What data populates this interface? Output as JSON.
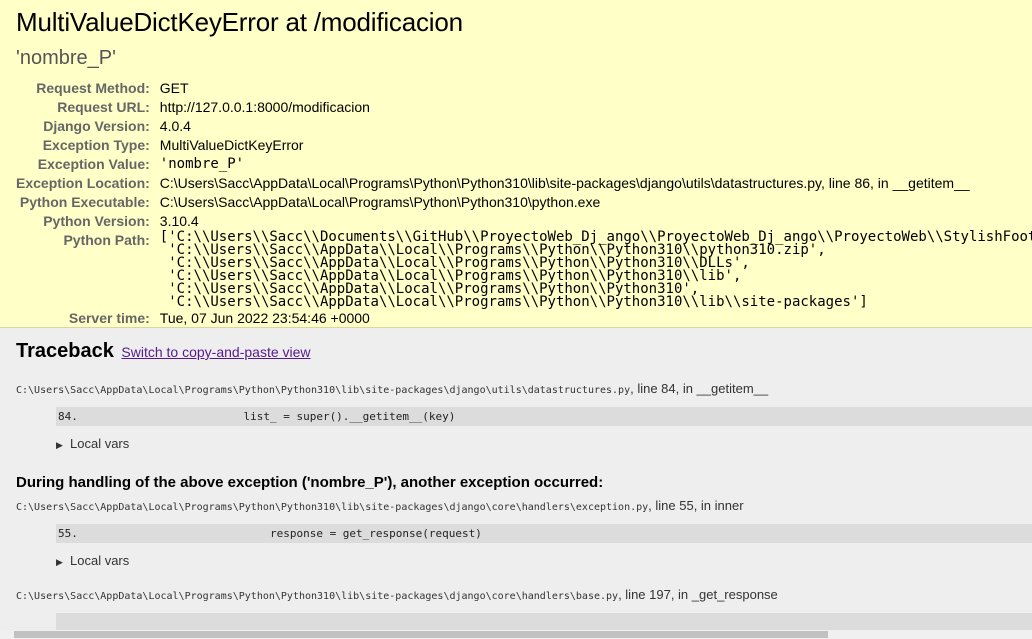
{
  "summary": {
    "title": "MultiValueDictKeyError at /modificacion",
    "subtitle": "'nombre_P'",
    "rows": [
      {
        "label": "Request Method:",
        "value": "GET"
      },
      {
        "label": "Request URL:",
        "value": "http://127.0.0.1:8000/modificacion"
      },
      {
        "label": "Django Version:",
        "value": "4.0.4"
      },
      {
        "label": "Exception Type:",
        "value": "MultiValueDictKeyError"
      },
      {
        "label": "Exception Value:",
        "value": "'nombre_P'"
      },
      {
        "label": "Exception Location:",
        "value": "C:\\Users\\Sacc\\AppData\\Local\\Programs\\Python\\Python310\\lib\\site-packages\\django\\utils\\datastructures.py, line 86, in __getitem__"
      },
      {
        "label": "Python Executable:",
        "value": "C:\\Users\\Sacc\\AppData\\Local\\Programs\\Python\\Python310\\python.exe"
      },
      {
        "label": "Python Version:",
        "value": "3.10.4"
      }
    ],
    "python_path_label": "Python Path:",
    "python_path": [
      "['C:\\\\Users\\\\Sacc\\\\Documents\\\\GitHub\\\\ProyectoWeb_Dj_ango\\\\ProyectoWeb_Dj_ango\\\\ProyectoWeb\\\\StylishFoot',",
      " 'C:\\\\Users\\\\Sacc\\\\AppData\\\\Local\\\\Programs\\\\Python\\\\Python310\\\\python310.zip',",
      " 'C:\\\\Users\\\\Sacc\\\\AppData\\\\Local\\\\Programs\\\\Python\\\\Python310\\\\DLLs',",
      " 'C:\\\\Users\\\\Sacc\\\\AppData\\\\Local\\\\Programs\\\\Python\\\\Python310\\\\lib',",
      " 'C:\\\\Users\\\\Sacc\\\\AppData\\\\Local\\\\Programs\\\\Python\\\\Python310',",
      " 'C:\\\\Users\\\\Sacc\\\\AppData\\\\Local\\\\Programs\\\\Python\\\\Python310\\\\lib\\\\site-packages']"
    ],
    "server_time_label": "Server time:",
    "server_time": "Tue, 07 Jun 2022 23:54:46 +0000"
  },
  "traceback": {
    "heading": "Traceback",
    "switch_link": "Switch to copy-and-paste view",
    "frame1": {
      "path": "C:\\Users\\Sacc\\AppData\\Local\\Programs\\Python\\Python310\\lib\\site-packages\\django\\utils\\datastructures.py",
      "suffix": ", line 84, in __getitem__",
      "line_no": "84.",
      "code": "            list_ = super().__getitem__(key)",
      "local_vars": "Local vars"
    },
    "handling_message": "During handling of the above exception ('nombre_P'), another exception occurred:",
    "frame2": {
      "path": "C:\\Users\\Sacc\\AppData\\Local\\Programs\\Python\\Python310\\lib\\site-packages\\django\\core\\handlers\\exception.py",
      "suffix": ", line 55, in inner",
      "line_no": "55.",
      "code": "                response = get_response(request)",
      "local_vars": "Local vars"
    },
    "frame3": {
      "path": "C:\\Users\\Sacc\\AppData\\Local\\Programs\\Python\\Python310\\lib\\site-packages\\django\\core\\handlers\\base.py",
      "suffix": ", line 197, in _get_response"
    }
  },
  "colors": {
    "summary_bg": "#ffffc8",
    "page_bg": "#eeeeee",
    "link": "#551a8b",
    "codeline_bg": "#dcdcdc"
  }
}
